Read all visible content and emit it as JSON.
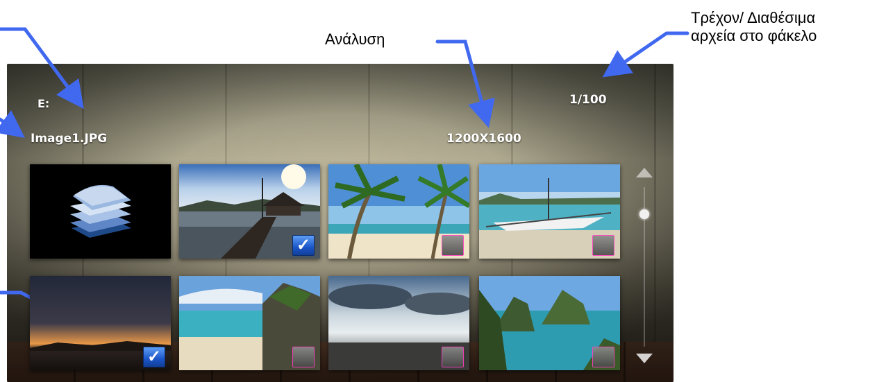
{
  "callouts": {
    "resolution_label": "Ανάλυση",
    "count_label_line1": "Τρέχον/ Διαθέσιμα",
    "count_label_line2": "αρχεία στο φάκελο"
  },
  "screen": {
    "drive": "E:",
    "file_name": "Image1.JPG",
    "resolution": "1200X1600",
    "counter": "1/100"
  },
  "thumbnails": [
    {
      "name": "folder",
      "icon": "folder-stack-icon",
      "mark": "none"
    },
    {
      "name": "pier-sunset",
      "mark": "checked"
    },
    {
      "name": "palm-beach",
      "mark": "unchecked"
    },
    {
      "name": "outrigger-boat",
      "mark": "unchecked"
    },
    {
      "name": "dusk-horizon",
      "mark": "checked"
    },
    {
      "name": "cliff-beach",
      "mark": "unchecked"
    },
    {
      "name": "cloudy-sea",
      "mark": "unchecked"
    },
    {
      "name": "lagoon-islands",
      "mark": "unchecked"
    }
  ],
  "check_glyph": "✓",
  "colors": {
    "arrow": "#4169f0",
    "checkbox_blue": "#1a56c8",
    "hud_text": "#ffffff"
  }
}
